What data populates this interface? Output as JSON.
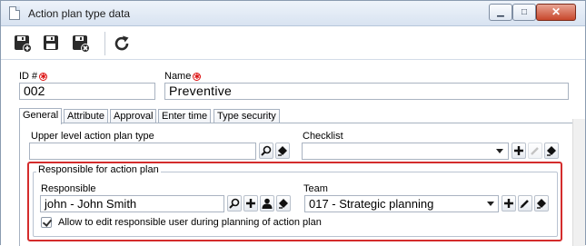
{
  "window": {
    "title": "Action plan type data",
    "minimize_glyph": "▁",
    "maximize_glyph": "□",
    "close_glyph": "✕"
  },
  "toolbar": {
    "icons": [
      "save-new-icon",
      "save-icon",
      "save-close-icon",
      "refresh-icon"
    ]
  },
  "form": {
    "id_label": "ID #",
    "id_value": "002",
    "name_label": "Name",
    "name_value": "Preventive",
    "required_glyph": "✱"
  },
  "tabs": [
    {
      "label": "General",
      "active": true
    },
    {
      "label": "Attribute",
      "active": false
    },
    {
      "label": "Approval",
      "active": false
    },
    {
      "label": "Enter time",
      "active": false
    },
    {
      "label": "Type security",
      "active": false
    }
  ],
  "general": {
    "upper_label": "Upper level action plan type",
    "upper_value": "",
    "checklist_label": "Checklist",
    "checklist_value": ""
  },
  "responsible_group": {
    "title": "Responsible for action plan",
    "responsible_label": "Responsible",
    "responsible_value": "john - John Smith",
    "team_label": "Team",
    "team_value": "017 - Strategic planning",
    "allow_edit_label": "Allow to edit responsible user during planning of action plan",
    "allow_edit_checked": true
  },
  "colors": {
    "highlight": "#d42c2c",
    "required": "#dd1111"
  }
}
